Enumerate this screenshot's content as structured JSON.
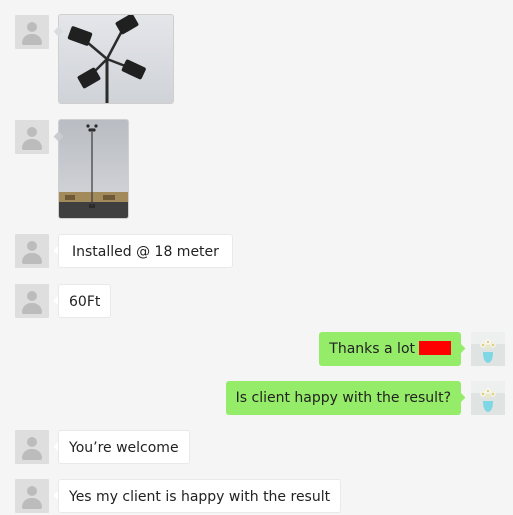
{
  "messages": [
    {
      "id": "m1",
      "side": "incoming",
      "kind": "image",
      "subject": "four-head-light-fixture"
    },
    {
      "id": "m2",
      "side": "incoming",
      "kind": "image",
      "subject": "light-pole-parking-lot"
    },
    {
      "id": "m3",
      "side": "incoming",
      "kind": "text",
      "text": "Installed @ 18 meter"
    },
    {
      "id": "m4",
      "side": "incoming",
      "kind": "text",
      "text": "60Ft"
    },
    {
      "id": "m5",
      "side": "outgoing",
      "kind": "text",
      "text": "Thanks a lot",
      "redaction_color": "#ff0000"
    },
    {
      "id": "m6",
      "side": "outgoing",
      "kind": "text",
      "text": "Is client happy with the result?"
    },
    {
      "id": "m7",
      "side": "incoming",
      "kind": "text",
      "text": "You’re welcome"
    },
    {
      "id": "m8",
      "side": "incoming",
      "kind": "text",
      "text": "Yes my client is happy with the result"
    }
  ],
  "colors": {
    "background": "#f5f5f5",
    "incoming_bubble": "#ffffff",
    "outgoing_bubble": "#95ec69",
    "placeholder_avatar": "#dedede"
  }
}
